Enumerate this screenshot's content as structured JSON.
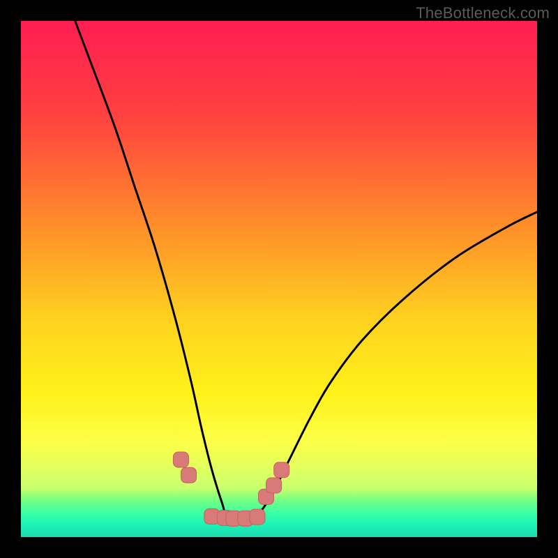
{
  "watermark": "TheBottleneck.com",
  "colors": {
    "background": "#000000",
    "curve": "#000000",
    "marker_fill": "#d87a78",
    "marker_stroke": "#c8605e",
    "gradient_stops": [
      {
        "offset": 0.0,
        "color": "#ff1d52"
      },
      {
        "offset": 0.18,
        "color": "#ff4040"
      },
      {
        "offset": 0.4,
        "color": "#ff8f2a"
      },
      {
        "offset": 0.58,
        "color": "#ffd21f"
      },
      {
        "offset": 0.72,
        "color": "#fff11a"
      },
      {
        "offset": 0.82,
        "color": "#fcff4a"
      },
      {
        "offset": 0.905,
        "color": "#c9ff6e"
      },
      {
        "offset": 0.93,
        "color": "#6fff83"
      },
      {
        "offset": 0.953,
        "color": "#3dffa5"
      },
      {
        "offset": 0.975,
        "color": "#1cf5b5"
      },
      {
        "offset": 1.0,
        "color": "#1bd9b0"
      }
    ]
  },
  "chart_data": {
    "type": "line",
    "title": "",
    "xlabel": "",
    "ylabel": "",
    "xlim": [
      0,
      100
    ],
    "ylim": [
      0,
      100
    ],
    "grid": false,
    "legend": false,
    "series": [
      {
        "name": "bottleneck-curve",
        "x": [
          0,
          6,
          12,
          18,
          22,
          26,
          30,
          33,
          35,
          37,
          39,
          40,
          43,
          46,
          49,
          52,
          56,
          60,
          66,
          74,
          84,
          94,
          100
        ],
        "values": [
          128,
          112,
          96,
          80,
          68,
          56,
          42,
          30,
          21,
          13,
          6.5,
          4.0,
          3.5,
          4.5,
          9.0,
          15,
          23,
          30,
          38,
          46,
          54,
          60,
          63
        ]
      }
    ],
    "markers": {
      "name": "highlight-points",
      "x": [
        31.0,
        32.5,
        37.0,
        39.5,
        41.2,
        43.5,
        45.8,
        47.5,
        49.0,
        50.5
      ],
      "values": [
        15.0,
        12.0,
        4.0,
        3.7,
        3.6,
        3.6,
        3.9,
        7.8,
        10.0,
        13.0
      ]
    }
  }
}
